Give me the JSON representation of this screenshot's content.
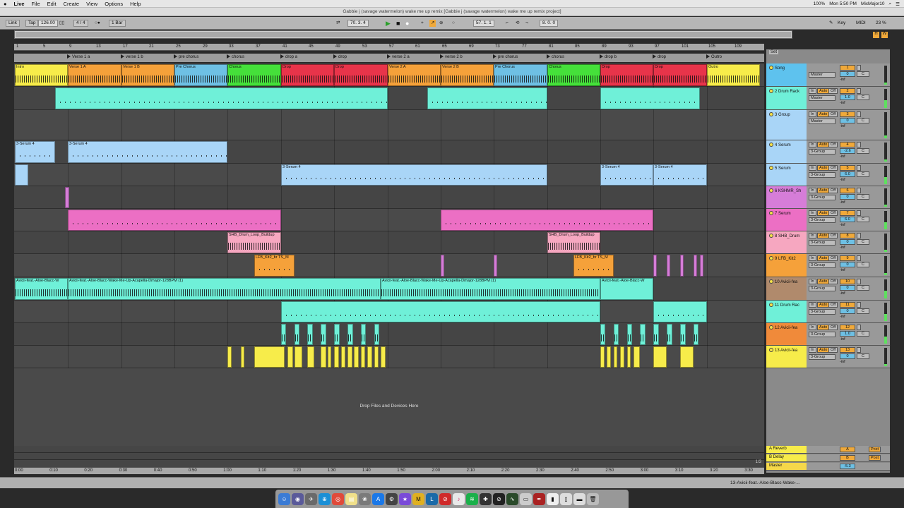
{
  "menubar": {
    "apple": "",
    "app": "Live",
    "items": [
      "File",
      "Edit",
      "Create",
      "View",
      "Options",
      "Help"
    ],
    "clock": "Mon 5:50 PM",
    "user": "MixMajor10",
    "battery": "100%"
  },
  "window": {
    "title": "Gabbie j (savage watermelon) wake me up remix  [Gabbie j (savage watermelon) wake me up remix project]"
  },
  "transport": {
    "link": "Link",
    "tap": "Tap",
    "tempo": "126.00",
    "sig": "4 / 4",
    "quant": "1 Bar",
    "position": "70.   3.   4",
    "loop_start": "57.   1.   1",
    "loop_len": "8.   0.   0",
    "key": "Key",
    "midi": "MIDI",
    "cpu": "23 %",
    "overview_controls": [
      "H",
      "W"
    ]
  },
  "ruler": {
    "bars": [
      "1",
      "5",
      "9",
      "13",
      "17",
      "21",
      "25",
      "29",
      "33",
      "37",
      "41",
      "45",
      "49",
      "53",
      "57",
      "61",
      "65",
      "69",
      "73",
      "77",
      "81",
      "85",
      "89",
      "93",
      "97",
      "101",
      "105",
      "109"
    ]
  },
  "locators": [
    "Verse 1 a",
    "verse 1 b",
    "pre chorus",
    "chorus",
    "drop a",
    "drop",
    "verse 2 a",
    "verse 2 b",
    "pre chorus",
    "chorus",
    "drop b",
    "drop",
    "Outro"
  ],
  "arrangement": {
    "drop_text": "Drop Files and Devices Here",
    "time_ruler": [
      "0:00",
      "0:10",
      "0:20",
      "0:30",
      "0:40",
      "0:50",
      "1:00",
      "1:10",
      "1:20",
      "1:30",
      "1:40",
      "1:50",
      "2:00",
      "2:10",
      "2:20",
      "2:30",
      "2:40",
      "2:50",
      "3:00",
      "3:10",
      "3:20",
      "3:30"
    ],
    "page": "1/3",
    "song_clips": [
      "Intro",
      "Verse 1 A",
      "Verse 1 B",
      "Pre Chorus",
      "Chorus",
      "Drop",
      "Drop",
      "Verse 2 A",
      "Verse 2 B",
      "Pre Chorus",
      "Chorus",
      "Drop",
      "Drop",
      "Outro"
    ],
    "serum_clip": "3-Serum 4",
    "shb_clip": "SHB_Drum_Loop_Buildup",
    "lfb_clip": "LFB_Kit2_br TS_M",
    "avicii_clip_a": "Avicii-feat.-Aloe-Blacc-W",
    "avicii_clip_b": "Avicii-feat.-Aloe-Blacc-Wake-Me-Up-Acapella-Dmajor-128BPM (1)",
    "avicii_clip_c": "Avicii-feat.-Aloe-Blacc-W"
  },
  "mixer": {
    "set": "Set",
    "tracks": [
      {
        "name": "Song",
        "num": "1",
        "route": "Master",
        "vol": "0",
        "pan": "C",
        "peak": "-inf",
        "color": "#5ec2ee"
      },
      {
        "name": "2 Drum Rack",
        "num": "2",
        "route": "Master",
        "vol": "1.0",
        "pan": "C",
        "peak": "-inf",
        "color": "#6ff0d8"
      },
      {
        "name": "3 Group",
        "num": "3",
        "route": "Master",
        "vol": "0",
        "pan": "C",
        "peak": "-inf",
        "color": "#a9d5f7"
      },
      {
        "name": "4 Serum",
        "num": "4",
        "route": "3-Group",
        "vol": "-2.6",
        "pan": "C",
        "peak": "-inf",
        "color": "#a9d5f7"
      },
      {
        "name": "5 Serum",
        "num": "5",
        "route": "3-Group",
        "vol": "6.0",
        "pan": "C",
        "peak": "-inf",
        "color": "#a9d5f7"
      },
      {
        "name": "6 KSHMR_Sh",
        "num": "6",
        "route": "3-Group",
        "vol": "0",
        "pan": "C",
        "peak": "-inf",
        "color": "#d67dd8"
      },
      {
        "name": "7 Serum",
        "num": "7",
        "route": "3-Group",
        "vol": "6.0",
        "pan": "C",
        "peak": "-inf",
        "color": "#ec6fc4"
      },
      {
        "name": "8 SHB_Drum",
        "num": "8",
        "route": "3-Group",
        "vol": "0",
        "pan": "C",
        "peak": "-inf",
        "color": "#f6a7c0"
      },
      {
        "name": "9 LFB_Kit2",
        "num": "9",
        "route": "3-Group",
        "vol": "0",
        "pan": "C",
        "peak": "-inf",
        "color": "#f5a13a"
      },
      {
        "name": "10 Avicii-fea",
        "num": "10",
        "route": "3-Group",
        "vol": "0",
        "pan": "C",
        "peak": "-inf",
        "color": "#b08a6c"
      },
      {
        "name": "11 Drum Rac",
        "num": "11",
        "route": "3-Group",
        "vol": "0",
        "pan": "C",
        "peak": "-inf",
        "color": "#6ff0d8"
      },
      {
        "name": "12 Avicii-fea",
        "num": "12",
        "route": "3-Group",
        "vol": "1.0",
        "pan": "C",
        "peak": "-inf",
        "color": "#f08a3a"
      },
      {
        "name": "13 Avicii-fea",
        "num": "13",
        "route": "3-Group",
        "vol": "0",
        "pan": "C",
        "peak": "-inf",
        "color": "#f7ec4a"
      }
    ],
    "returns": [
      {
        "name": "A Reverb",
        "num": "A",
        "mode": "Post"
      },
      {
        "name": "B Delay",
        "num": "B",
        "mode": "Post"
      },
      {
        "name": "Master",
        "num": "1/2",
        "vol": "-5.3",
        "pan": "0"
      }
    ],
    "in": "In",
    "auto": "Auto",
    "off": "Off"
  },
  "status": {
    "clip": "13-Avicii-feat.-Aloe-Blacc-Wake-..."
  }
}
